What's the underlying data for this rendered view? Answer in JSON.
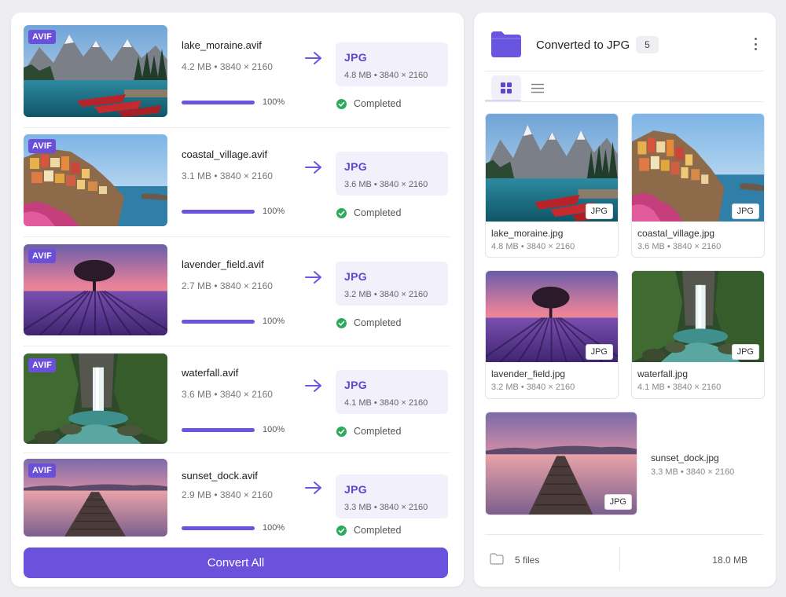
{
  "left_panel": {
    "items": [
      {
        "src_name": "lake_moraine.avif",
        "src_meta": "4.2 MB • 3840 × 2160",
        "src_badge": "AVIF",
        "progress_pct": 100,
        "progress_label": "100%",
        "out_format": "JPG",
        "out_meta": "4.8 MB • 3840 × 2160",
        "status": "Completed",
        "scene": "lake"
      },
      {
        "src_name": "coastal_village.avif",
        "src_meta": "3.1 MB • 3840 × 2160",
        "src_badge": "AVIF",
        "progress_pct": 100,
        "progress_label": "100%",
        "out_format": "JPG",
        "out_meta": "3.6 MB • 3840 × 2160",
        "status": "Completed",
        "scene": "village"
      },
      {
        "src_name": "lavender_field.avif",
        "src_meta": "2.7 MB • 3840 × 2160",
        "src_badge": "AVIF",
        "progress_pct": 100,
        "progress_label": "100%",
        "out_format": "JPG",
        "out_meta": "3.2 MB • 3840 × 2160",
        "status": "Completed",
        "scene": "lavender"
      },
      {
        "src_name": "waterfall.avif",
        "src_meta": "3.6 MB • 3840 × 2160",
        "src_badge": "AVIF",
        "progress_pct": 100,
        "progress_label": "100%",
        "out_format": "JPG",
        "out_meta": "4.1 MB • 3840 × 2160",
        "status": "Completed",
        "scene": "waterfall"
      },
      {
        "src_name": "sunset_dock.avif",
        "src_meta": "2.9 MB • 3840 × 2160",
        "src_badge": "AVIF",
        "progress_pct": 100,
        "progress_label": "100%",
        "out_format": "JPG",
        "out_meta": "3.3 MB • 3840 × 2160",
        "status": "Completed",
        "scene": "dock"
      }
    ],
    "convert_button": "Convert All"
  },
  "right_panel": {
    "title": "Converted to JPG",
    "count": "5",
    "view_mode": "grid",
    "files": [
      {
        "name": "lake_moraine.jpg",
        "meta": "4.8 MB • 3840 × 2160",
        "tag": "JPG"
      },
      {
        "name": "coastal_village.jpg",
        "meta": "3.6 MB • 3840 × 2160",
        "tag": "JPG"
      },
      {
        "name": "lavender_field.jpg",
        "meta": "3.2 MB • 3840 × 2160",
        "tag": "JPG"
      },
      {
        "name": "waterfall.jpg",
        "meta": "4.1 MB • 3840 × 2160",
        "tag": "JPG"
      },
      {
        "name": "sunset_dock.jpg",
        "meta": "3.3 MB • 3840 × 2160",
        "tag": "JPG"
      }
    ],
    "footer": {
      "files_label": "5 files",
      "total_size": "18.0 MB"
    }
  },
  "colors": {
    "accent": "#6a52dc",
    "success": "#2eaa5c",
    "folder": "#6a55e0"
  },
  "icons": {
    "arrow": "arrow-right-icon",
    "folder": "folder-icon",
    "status": "check-circle-icon",
    "menu": "kebab-menu-icon",
    "grid": "grid-view-icon",
    "list": "list-view-icon"
  }
}
